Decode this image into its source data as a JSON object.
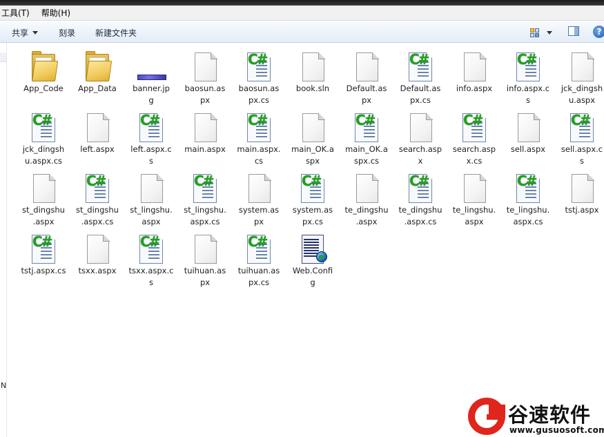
{
  "menubar": {
    "items": [
      "工具(T)",
      "帮助(H)"
    ]
  },
  "toolbar": {
    "share_label": "共享",
    "burn_label": "刻录",
    "new_folder_label": "新建文件夹",
    "help_label": "?"
  },
  "leftnav": {
    "fragment": "N"
  },
  "files": [
    {
      "name": "App_Code",
      "label": "App_Code",
      "type": "folder"
    },
    {
      "name": "App_Data",
      "label": "App_Data",
      "type": "folder"
    },
    {
      "name": "banner.jpg",
      "label": "banner.jp\ng",
      "type": "image"
    },
    {
      "name": "baosun.aspx",
      "label": "baosun.as\npx",
      "type": "page"
    },
    {
      "name": "baosun.aspx.cs",
      "label": "baosun.as\npx.cs",
      "type": "cs"
    },
    {
      "name": "book.sln",
      "label": "book.sln",
      "type": "page"
    },
    {
      "name": "Default.aspx",
      "label": "Default.as\npx",
      "type": "page"
    },
    {
      "name": "Default.aspx.cs",
      "label": "Default.as\npx.cs",
      "type": "cs"
    },
    {
      "name": "info.aspx",
      "label": "info.aspx",
      "type": "page"
    },
    {
      "name": "info.aspx.cs",
      "label": "info.aspx.c\ns",
      "type": "cs"
    },
    {
      "name": "jck_dingshu.aspx",
      "label": "jck_dingsh\nu.aspx",
      "type": "page"
    },
    {
      "name": "jck_dingshu.aspx.cs",
      "label": "jck_dingsh\nu.aspx.cs",
      "type": "cs"
    },
    {
      "name": "left.aspx",
      "label": "left.aspx",
      "type": "page"
    },
    {
      "name": "left.aspx.cs",
      "label": "left.aspx.c\ns",
      "type": "cs"
    },
    {
      "name": "main.aspx",
      "label": "main.aspx",
      "type": "page"
    },
    {
      "name": "main.aspx.cs",
      "label": "main.aspx.\ncs",
      "type": "cs"
    },
    {
      "name": "main_OK.aspx",
      "label": "main_OK.a\nspx",
      "type": "page"
    },
    {
      "name": "main_OK.aspx.cs",
      "label": "main_OK.a\nspx.cs",
      "type": "cs"
    },
    {
      "name": "search.aspx",
      "label": "search.asp\nx",
      "type": "page"
    },
    {
      "name": "search.aspx.cs",
      "label": "search.asp\nx.cs",
      "type": "cs"
    },
    {
      "name": "sell.aspx",
      "label": "sell.aspx",
      "type": "page"
    },
    {
      "name": "sell.aspx.cs",
      "label": "sell.aspx.c\ns",
      "type": "cs"
    },
    {
      "name": "st_dingshu.aspx",
      "label": "st_dingshu\n.aspx",
      "type": "page"
    },
    {
      "name": "st_dingshu.aspx.cs",
      "label": "st_dingshu\n.aspx.cs",
      "type": "cs"
    },
    {
      "name": "st_lingshu.aspx",
      "label": "st_lingshu.\naspx",
      "type": "page"
    },
    {
      "name": "st_lingshu.aspx.cs",
      "label": "st_lingshu.\naspx.cs",
      "type": "cs"
    },
    {
      "name": "system.aspx",
      "label": "system.as\npx",
      "type": "page"
    },
    {
      "name": "system.aspx.cs",
      "label": "system.as\npx.cs",
      "type": "cs"
    },
    {
      "name": "te_dingshu.aspx",
      "label": "te_dingshu\n.aspx",
      "type": "page"
    },
    {
      "name": "te_dingshu.aspx.cs",
      "label": "te_dingshu\n.aspx.cs",
      "type": "cs"
    },
    {
      "name": "te_lingshu.aspx",
      "label": "te_lingshu.\naspx",
      "type": "page"
    },
    {
      "name": "te_lingshu.aspx.cs",
      "label": "te_lingshu.\naspx.cs",
      "type": "cs"
    },
    {
      "name": "tstj.aspx",
      "label": "tstj.aspx",
      "type": "page"
    },
    {
      "name": "tstj.aspx.cs",
      "label": "tstj.aspx.cs",
      "type": "cs"
    },
    {
      "name": "tsxx.aspx",
      "label": "tsxx.aspx",
      "type": "page"
    },
    {
      "name": "tsxx.aspx.cs",
      "label": "tsxx.aspx.c\ns",
      "type": "cs"
    },
    {
      "name": "tuihuan.aspx",
      "label": "tuihuan.as\npx",
      "type": "page"
    },
    {
      "name": "tuihuan.aspx.cs",
      "label": "tuihuan.as\npx.cs",
      "type": "cs"
    },
    {
      "name": "Web.Config",
      "label": "Web.Confi\ng",
      "type": "config"
    }
  ],
  "icons": {
    "cs_glyph": "C#"
  },
  "watermark": {
    "title": "谷速软件",
    "url": "www.gusuosoft.com"
  }
}
